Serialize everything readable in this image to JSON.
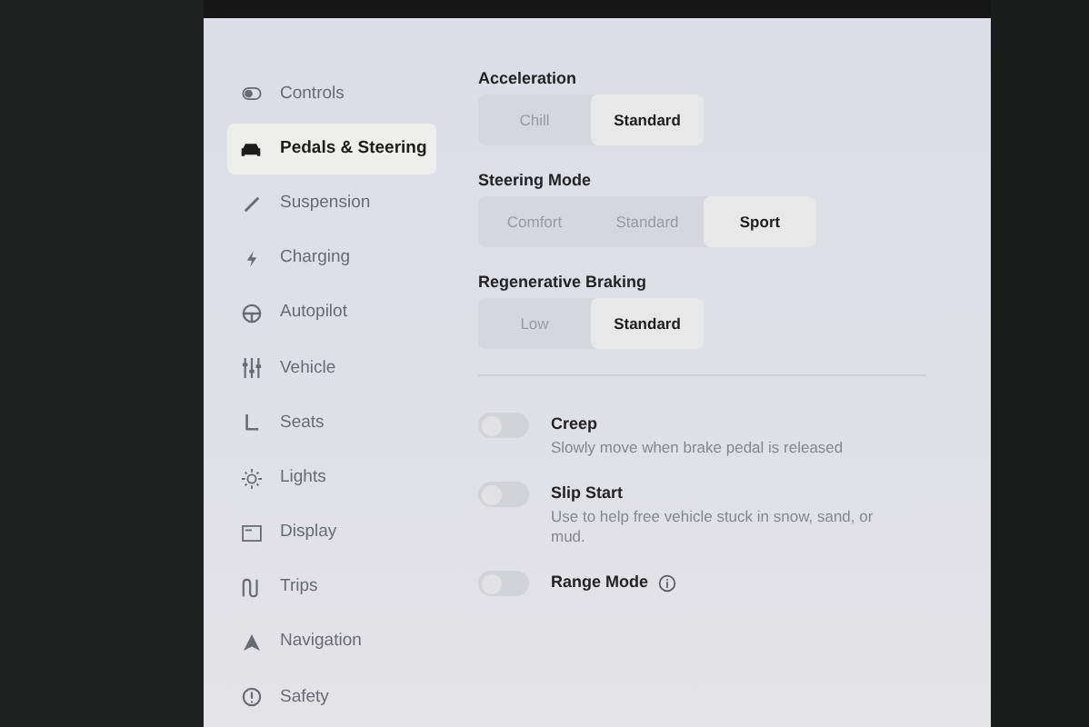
{
  "sidebar": {
    "items": [
      {
        "label": "Controls",
        "selected": false
      },
      {
        "label": "Pedals & Steering",
        "selected": true
      },
      {
        "label": "Suspension",
        "selected": false
      },
      {
        "label": "Charging",
        "selected": false
      },
      {
        "label": "Autopilot",
        "selected": false
      },
      {
        "label": "Vehicle",
        "selected": false
      },
      {
        "label": "Seats",
        "selected": false
      },
      {
        "label": "Lights",
        "selected": false
      },
      {
        "label": "Display",
        "selected": false
      },
      {
        "label": "Trips",
        "selected": false
      },
      {
        "label": "Navigation",
        "selected": false
      },
      {
        "label": "Safety",
        "selected": false
      }
    ]
  },
  "segments": [
    {
      "title": "Acceleration",
      "options": [
        {
          "label": "Chill",
          "selected": false
        },
        {
          "label": "Standard",
          "selected": true
        }
      ]
    },
    {
      "title": "Steering Mode",
      "options": [
        {
          "label": "Comfort",
          "selected": false
        },
        {
          "label": "Standard",
          "selected": false
        },
        {
          "label": "Sport",
          "selected": true
        }
      ]
    },
    {
      "title": "Regenerative Braking",
      "options": [
        {
          "label": "Low",
          "selected": false
        },
        {
          "label": "Standard",
          "selected": true
        }
      ]
    }
  ],
  "toggles": [
    {
      "title": "Creep",
      "description": "Slowly move when brake pedal is released",
      "on": false,
      "info": false
    },
    {
      "title": "Slip Start",
      "description": "Use to help free vehicle stuck in snow, sand, or mud.",
      "on": false,
      "info": false
    },
    {
      "title": "Range Mode",
      "on": false,
      "info": true
    }
  ]
}
